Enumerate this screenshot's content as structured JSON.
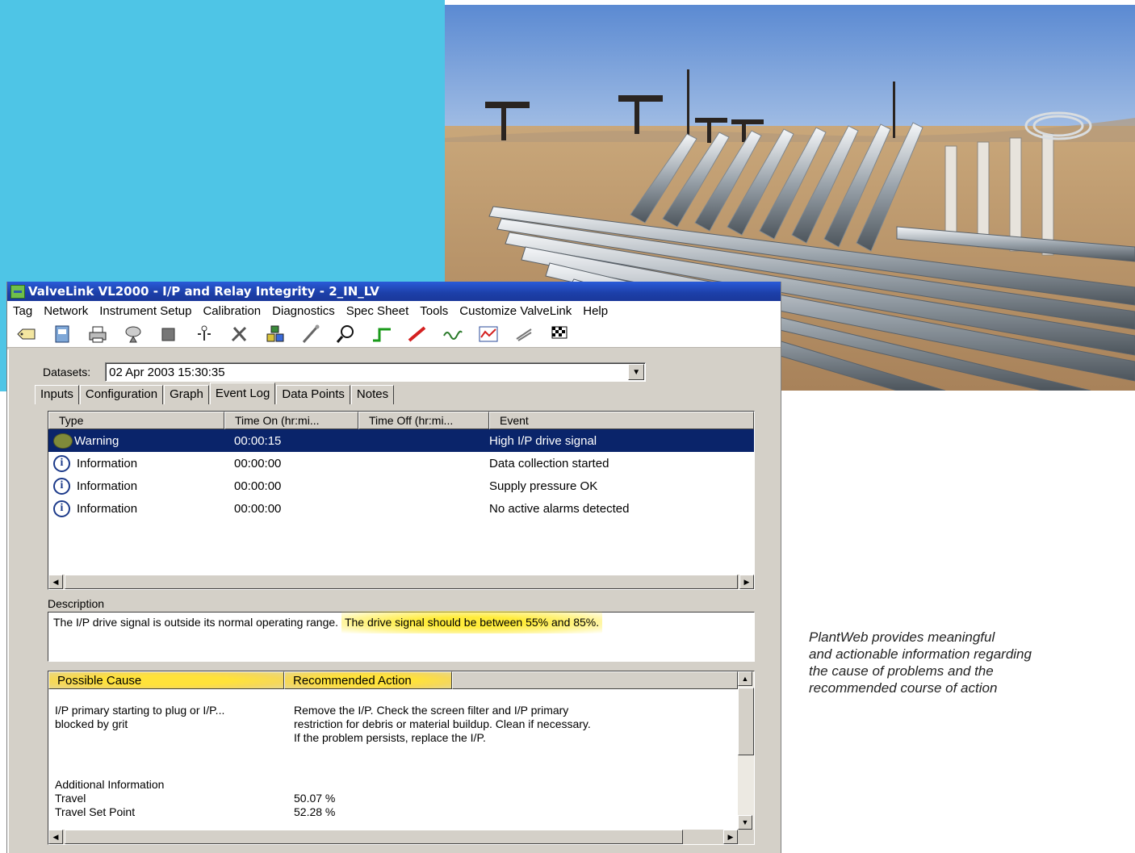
{
  "window": {
    "title": "ValveLink VL2000 - I/P and Relay Integrity - 2_IN_LV"
  },
  "menu": [
    "Tag",
    "Network",
    "Instrument Setup",
    "Calibration",
    "Diagnostics",
    "Spec Sheet",
    "Tools",
    "Customize ValveLink",
    "Help"
  ],
  "toolbar": {
    "icons": [
      "tag-icon",
      "notebook-icon",
      "printer-icon",
      "satellite-icon",
      "square-icon",
      "connector-icon",
      "tools-icon",
      "blocks-icon",
      "probe-icon",
      "magnifier-icon",
      "step-icon",
      "ramp-icon",
      "wave-icon",
      "graph-icon",
      "flag-outline-icon",
      "checkered-flag-icon"
    ]
  },
  "datasets": {
    "label": "Datasets:",
    "value": "02 Apr 2003 15:30:35"
  },
  "tabs": [
    "Inputs",
    "Configuration",
    "Graph",
    "Event Log",
    "Data Points",
    "Notes"
  ],
  "event_log": {
    "columns": [
      "Type",
      "Time On (hr:mi...",
      "Time Off (hr:mi...",
      "Event"
    ],
    "rows": [
      {
        "type": "Warning",
        "time_on": "00:00:15",
        "time_off": "",
        "event": "High I/P drive signal"
      },
      {
        "type": "Information",
        "time_on": "00:00:00",
        "time_off": "",
        "event": "Data collection started"
      },
      {
        "type": "Information",
        "time_on": "00:00:00",
        "time_off": "",
        "event": "Supply pressure OK"
      },
      {
        "type": "Information",
        "time_on": "00:00:00",
        "time_off": "",
        "event": "No active alarms detected"
      }
    ]
  },
  "description": {
    "label": "Description",
    "text_plain": "The I/P drive signal is outside its normal operating range.",
    "text_highlight": "The drive signal should be between 55% and 85%."
  },
  "cause": {
    "col1": "Possible Cause",
    "col2": "Recommended Action",
    "cause_line1": "I/P primary starting to plug or I/P...",
    "cause_line2": "blocked by grit",
    "action_line1": "Remove the I/P.  Check the screen filter and I/P primary",
    "action_line2": "restriction for debris or material buildup.  Clean if necessary.",
    "action_line3": "If the problem persists, replace the I/P.",
    "additional_label": "Additional Information",
    "travel_label": "Travel",
    "travel_value": "50.07 %",
    "setpoint_label": "Travel Set Point",
    "setpoint_value": "52.28 %"
  },
  "caption": {
    "line1": "PlantWeb provides meaningful",
    "line2": "and actionable information regarding",
    "line3": "the cause of problems and the",
    "line4": "recommended course of action"
  },
  "colors": {
    "cyan_panel": "#4EC5E6",
    "selection": "#0A246A",
    "highlight": "#FFEC3A"
  }
}
